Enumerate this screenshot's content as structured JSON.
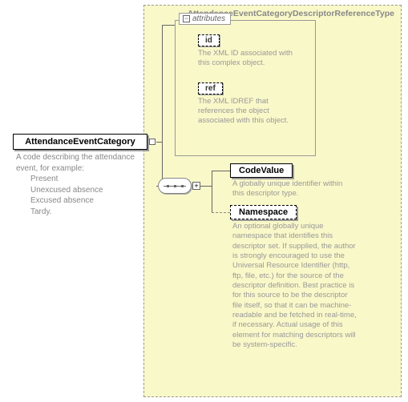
{
  "type_name": "AttendanceEventCategoryDescriptorReferenceType",
  "root": {
    "label": "AttendanceEventCategory",
    "desc_intro": "A code describing the attendance event, for example:",
    "values": [
      "Present",
      "Unexcused absence",
      "Excused absence",
      "Tardy."
    ]
  },
  "attributes": {
    "title": "attributes",
    "items": [
      {
        "name": "id",
        "desc": "The XML ID associated with this complex object."
      },
      {
        "name": "ref",
        "desc": "The XML IDREF that references the object associated with this object."
      }
    ]
  },
  "elements": [
    {
      "name": "CodeValue",
      "optional": false,
      "desc": "A globally unique identifier within this descriptor type."
    },
    {
      "name": "Namespace",
      "optional": true,
      "desc": "An optional globally unique namespace that identifies this descriptor set. If supplied, the author is strongly encouraged to use the Universal Resource Identifier (http, ftp, file, etc.) for the source of the descriptor definition. Best practice is for this source to be the descriptor file itself, so that it can be machine-readable and be fetched in real-time, if necessary. Actual usage of this element for matching descriptors will be system-specific."
    }
  ]
}
